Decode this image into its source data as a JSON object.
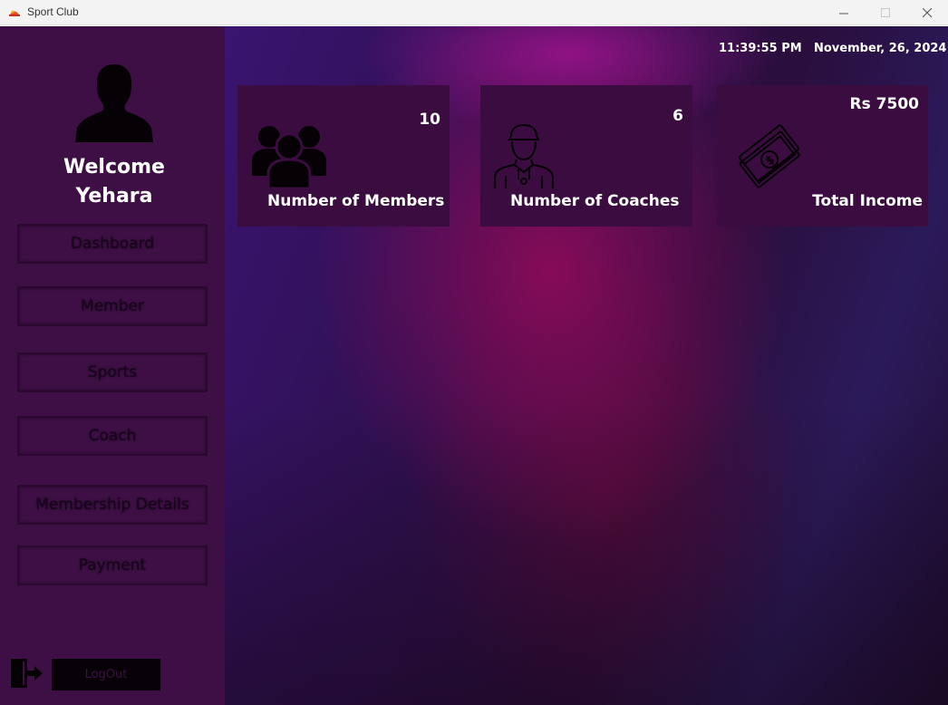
{
  "window": {
    "title": "Sport Club"
  },
  "sidebar": {
    "welcome_line1": "Welcome",
    "welcome_line2": "Yehara",
    "nav": [
      {
        "label": "Dashboard"
      },
      {
        "label": "Member"
      },
      {
        "label": "Sports"
      },
      {
        "label": "Coach"
      },
      {
        "label": "Membership Details"
      },
      {
        "label": "Payment"
      }
    ],
    "logout_label": "LogOut"
  },
  "header": {
    "time": "11:39:55 PM",
    "date": "November,  26, 2024"
  },
  "cards": {
    "members": {
      "value": "10",
      "label": "Number of Members",
      "icon": "users-icon"
    },
    "coaches": {
      "value": "6",
      "label": "Number of Coaches",
      "icon": "coach-icon"
    },
    "income": {
      "value": "Rs 7500",
      "label": "Total Income",
      "icon": "money-icon"
    }
  },
  "colors": {
    "sidebar": "#3d0f44",
    "card": "#3a0c40",
    "accent": "#9b1a8a"
  }
}
